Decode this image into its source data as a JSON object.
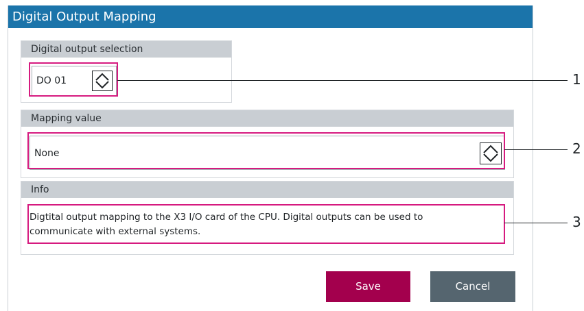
{
  "dialog": {
    "title": "Digital Output Mapping"
  },
  "digital_output": {
    "label": "Digital output selection",
    "value": "DO 01"
  },
  "mapping": {
    "label": "Mapping value",
    "value": "None"
  },
  "info": {
    "label": "Info",
    "line1": "Digtital output mapping to the X3 I/O card of the CPU. Digital outputs can be used to",
    "line2": "communicate with external systems."
  },
  "buttons": {
    "save": "Save",
    "cancel": "Cancel"
  },
  "callouts": {
    "one": "1",
    "two": "2",
    "three": "3"
  },
  "colors": {
    "title_bar": "#1b74aa",
    "highlight": "#d61a7f",
    "save_button": "#a3004d",
    "cancel_button": "#55656f",
    "section_header": "#c9ced3"
  }
}
